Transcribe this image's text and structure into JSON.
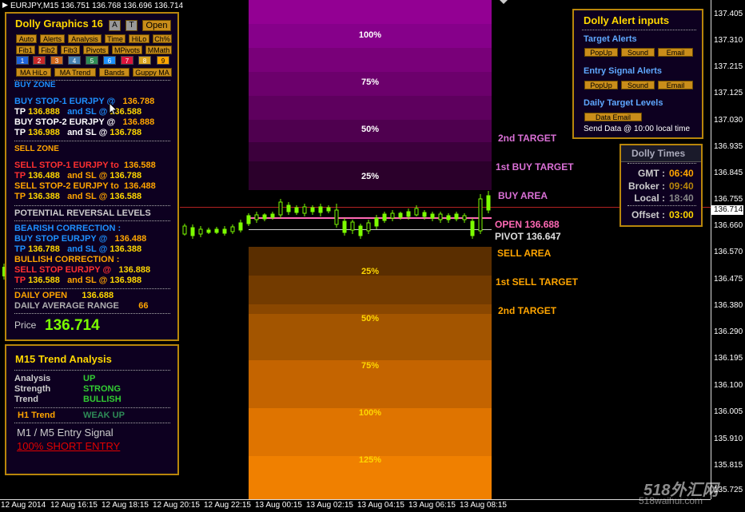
{
  "header": {
    "symbol": "EURJPY,M15",
    "ohlc": "136.751 136.768 136.696 136.714"
  },
  "colors": {
    "buy_top": "#930093",
    "sell_bottom": "#ff8c00",
    "panel_border": "#b8860b"
  },
  "price_scale": {
    "ticks": [
      "137.405",
      "137.310",
      "137.215",
      "137.125",
      "137.030",
      "136.935",
      "136.845",
      "136.755",
      "136.660",
      "136.570",
      "136.475",
      "136.380",
      "136.290",
      "136.195",
      "136.100",
      "136.005",
      "135.910",
      "135.815",
      "135.725"
    ],
    "current": "136.714"
  },
  "time_axis": [
    "12 Aug 2014",
    "12 Aug 16:15",
    "12 Aug 18:15",
    "12 Aug 20:15",
    "12 Aug 22:15",
    "13 Aug 00:15",
    "13 Aug 02:15",
    "13 Aug 04:15",
    "13 Aug 06:15",
    "13 Aug 08:15"
  ],
  "zones": {
    "buy_pcts": [
      "100%",
      "75%",
      "50%",
      "25%"
    ],
    "sell_pcts": [
      "25%",
      "50%",
      "75%",
      "100%",
      "125%"
    ],
    "labels": {
      "second_target_top": "2nd TARGET",
      "first_buy_target": "1st BUY TARGET",
      "buy_area": "BUY AREA",
      "open": "OPEN 136.688",
      "pivot": "PIVOT 136.647",
      "sell_area": "SELL AREA",
      "first_sell_target": "1st SELL TARGET",
      "second_target_bottom": "2nd TARGET"
    }
  },
  "graphics_panel": {
    "title": "Dolly Graphics 16",
    "btn_a": "A",
    "btn_t": "T",
    "btn_open": "Open",
    "row1": [
      "Auto",
      "Alerts",
      "Analysis",
      "Time",
      "HiLo",
      "Ch%"
    ],
    "row2": [
      "Fib1",
      "Fib2",
      "Fib3",
      "Pivots",
      "MPivots",
      "MMath"
    ],
    "nums": [
      "1",
      "2",
      "3",
      "4",
      "5",
      "6",
      "7",
      "8",
      "9"
    ],
    "row4": [
      "MA HiLo",
      "MA Trend",
      "Bands",
      "Guppy MA"
    ],
    "buy_zone": "BUY ZONE",
    "buy_stop1": "BUY STOP-1  EURJPY  @",
    "buy_stop1_val": "136.788",
    "tp1_label": "TP",
    "tp1_val": "136.888",
    "and_sl": "and SL @",
    "sl1_val": "136.588",
    "buy_stop2": "BUY STOP-2  EURJPY  @",
    "buy_stop2_val": "136.888",
    "tp2_val": "136.988",
    "sl2_val": "136.788",
    "sell_zone": "SELL ZONE",
    "sell_stop1": "SELL STOP-1  EURJPY to",
    "sell_stop1_val": "136.588",
    "tp3_val": "136.488",
    "sl3_val": "136.788",
    "sell_stop2": "SELL STOP-2  EURJPY to",
    "sell_stop2_val": "136.488",
    "tp4_val": "136.388",
    "sl4_val": "136.588",
    "reversal": "POTENTIAL REVERSAL LEVELS",
    "bearish": "BEARISH CORRECTION :",
    "buy_stop3": "BUY STOP EURJPY  @",
    "buy_stop3_val": "136.488",
    "tp5_val": "136.788",
    "sl5_val": "136.388",
    "bullish": "BULLISH CORRECTION :",
    "sell_stop3": "SELL STOP EURJPY  @",
    "sell_stop3_val": "136.888",
    "tp6_val": "136.588",
    "sl6_val": "136.988",
    "daily_open": "DAILY OPEN",
    "daily_open_val": "136.688",
    "dar": "DAILY AVERAGE RANGE",
    "dar_val": "66",
    "price_label": "Price",
    "price_val": "136.714"
  },
  "trend_panel": {
    "title": "M15 Trend Analysis",
    "analysis": "Analysis",
    "analysis_val": "UP",
    "strength": "Strength",
    "strength_val": "STRONG",
    "trend": "Trend",
    "trend_val": "BULLISH",
    "h1": "H1 Trend",
    "h1_val": "WEAK UP",
    "entry": "M1 /  M5 Entry Signal",
    "signal": "100% SHORT ENTRY"
  },
  "alert_panel": {
    "title": "Dolly Alert inputs",
    "target_alerts": "Target Alerts",
    "entry_alerts": "Entry Signal Alerts",
    "popup": "PopUp",
    "sound": "Sound",
    "email": "Email",
    "daily_levels": "Daily Target Levels",
    "data_email": "Data Email",
    "send_data": "Send Data @ 10:00 local time"
  },
  "times_panel": {
    "title": "Dolly Times",
    "gmt": "GMT :",
    "gmt_val": "06:40",
    "broker": "Broker :",
    "broker_val": "09:40",
    "local": "Local :",
    "local_val": "18:40",
    "offset": "Offset :",
    "offset_val": "03:00"
  },
  "watermark": {
    "main": "518外汇网",
    "sub": "518waihui.com"
  }
}
